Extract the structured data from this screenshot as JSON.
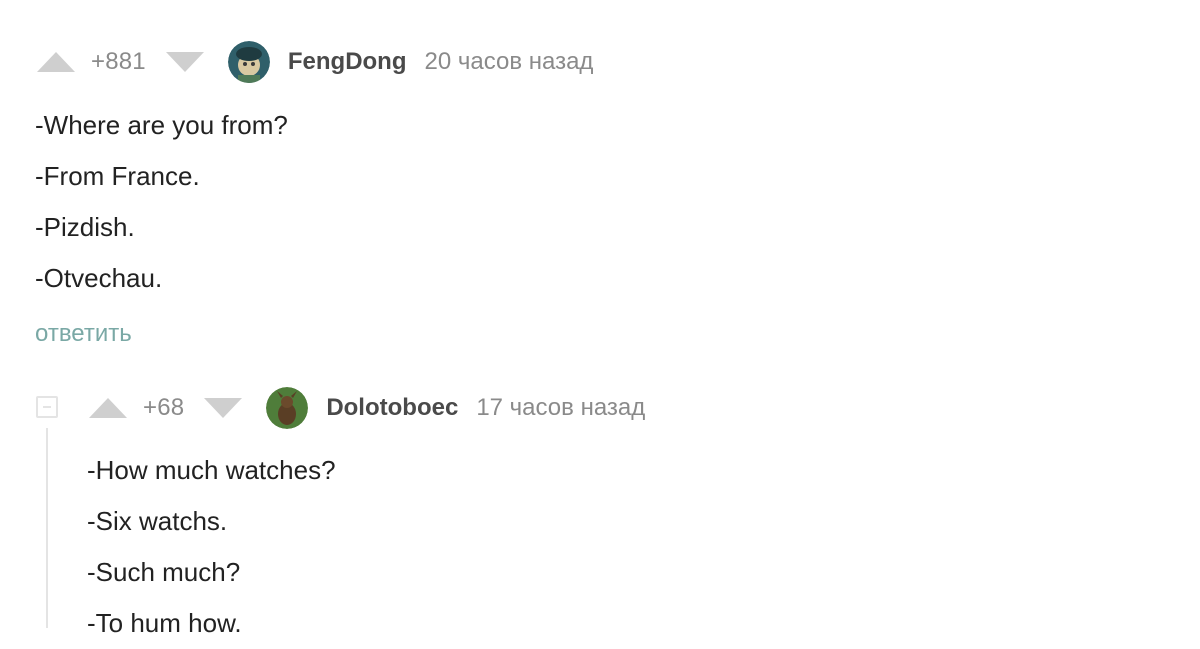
{
  "comments": [
    {
      "rating": "+881",
      "username": "FengDong",
      "timestamp": "20 часов назад",
      "lines": [
        "-Where are you from?",
        "-From France.",
        "-Pizdish.",
        "-Otvechau."
      ],
      "reply_label": "ответить"
    },
    {
      "rating": "+68",
      "username": "Dolotoboec",
      "timestamp": "17 часов назад",
      "lines": [
        "-How much watches?",
        "-Six watchs.",
        "-Such much?",
        "-To hum how."
      ]
    }
  ],
  "colors": {
    "vote_arrow": "#cfcfcf",
    "muted_text": "#8a8a8a",
    "reply_link": "#7aa8a5",
    "thread_line": "#e4e4e4"
  },
  "icons": {
    "vote_up": "triangle-up",
    "vote_down": "triangle-down",
    "collapse": "minus-square"
  }
}
